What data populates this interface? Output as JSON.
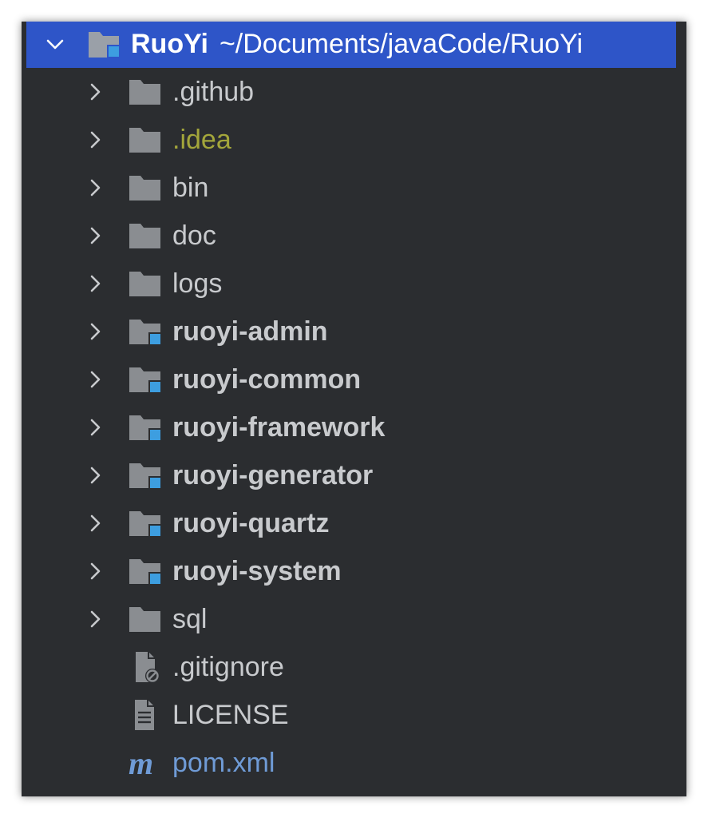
{
  "colors": {
    "panel_bg": "#2b2d30",
    "selection_bg": "#2e55c8",
    "folder_gray": "#8a8d91",
    "module_badge": "#3d9ee0",
    "excluded_text": "#a3a63b",
    "maven_text": "#6f9bd6",
    "default_text": "#c8cacd"
  },
  "root": {
    "name": "RuoYi",
    "path": "~/Documents/javaCode/RuoYi",
    "icon": "module-folder-icon",
    "expanded": true
  },
  "items": [
    {
      "label": ".github",
      "type": "folder",
      "icon": "folder-icon",
      "style": "normal",
      "expandable": true
    },
    {
      "label": ".idea",
      "type": "folder",
      "icon": "folder-icon",
      "style": "excluded",
      "expandable": true
    },
    {
      "label": "bin",
      "type": "folder",
      "icon": "folder-icon",
      "style": "normal",
      "expandable": true
    },
    {
      "label": "doc",
      "type": "folder",
      "icon": "folder-icon",
      "style": "normal",
      "expandable": true
    },
    {
      "label": "logs",
      "type": "folder",
      "icon": "folder-icon",
      "style": "normal",
      "expandable": true
    },
    {
      "label": "ruoyi-admin",
      "type": "module",
      "icon": "module-folder-icon",
      "style": "bold",
      "expandable": true
    },
    {
      "label": "ruoyi-common",
      "type": "module",
      "icon": "module-folder-icon",
      "style": "bold",
      "expandable": true
    },
    {
      "label": "ruoyi-framework",
      "type": "module",
      "icon": "module-folder-icon",
      "style": "bold",
      "expandable": true
    },
    {
      "label": "ruoyi-generator",
      "type": "module",
      "icon": "module-folder-icon",
      "style": "bold",
      "expandable": true
    },
    {
      "label": "ruoyi-quartz",
      "type": "module",
      "icon": "module-folder-icon",
      "style": "bold",
      "expandable": true
    },
    {
      "label": "ruoyi-system",
      "type": "module",
      "icon": "module-folder-icon",
      "style": "bold",
      "expandable": true
    },
    {
      "label": "sql",
      "type": "folder",
      "icon": "folder-icon",
      "style": "normal",
      "expandable": true
    },
    {
      "label": ".gitignore",
      "type": "file",
      "icon": "ignore-file-icon",
      "style": "normal",
      "expandable": false
    },
    {
      "label": "LICENSE",
      "type": "file",
      "icon": "text-file-icon",
      "style": "normal",
      "expandable": false
    },
    {
      "label": "pom.xml",
      "type": "file",
      "icon": "maven-icon",
      "style": "maven",
      "expandable": false
    }
  ]
}
